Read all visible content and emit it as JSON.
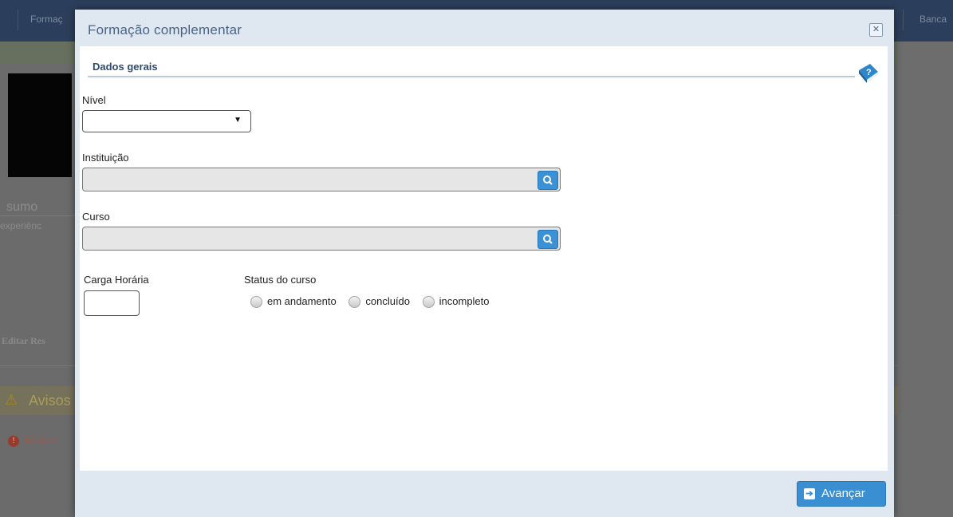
{
  "background": {
    "topbar_left": "Formaç",
    "topbar_right": "Banca",
    "section_heading": "sumo",
    "section_sub": "experiênc",
    "edit_link": "Editar Res",
    "warning_title": "Avisos",
    "error_text": "Existem"
  },
  "modal": {
    "title": "Formação complementar",
    "section_title": "Dados gerais",
    "fields": {
      "nivel_label": "Nível",
      "nivel_value": "",
      "instituicao_label": "Instituição",
      "instituicao_value": "",
      "curso_label": "Curso",
      "curso_value": "",
      "carga_label": "Carga Horária",
      "carga_value": "",
      "status_label": "Status do curso",
      "status_options": [
        "em andamento",
        "concluído",
        "incompleto"
      ]
    },
    "advance_button": "Avançar"
  },
  "colors": {
    "accent": "#3a8fd3",
    "modal_bg": "#dfe7f1",
    "title_text": "#4a6485"
  },
  "icons": [
    "close-icon",
    "help-book-icon",
    "search-icon",
    "arrow-right-icon"
  ]
}
